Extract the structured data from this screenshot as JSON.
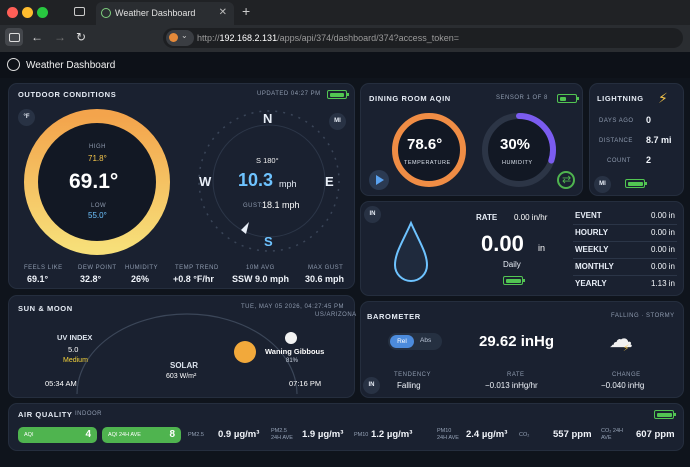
{
  "browser": {
    "tab_title": "Weather Dashboard",
    "url_prefix": "http://",
    "url_host": "192.168.2.131",
    "url_path": "/apps/api/374/dashboard/374?access_token="
  },
  "app": {
    "title": "Weather Dashboard"
  },
  "outdoor": {
    "title": "OUTDOOR CONDITIONS",
    "updated": "UPDATED 04:27 PM",
    "unit_badge": "°F",
    "high_label": "HIGH",
    "high": "71.8°",
    "temp": "69.1°",
    "low_label": "LOW",
    "low": "55.0°",
    "feels_label": "FEELS LIKE",
    "feels": "69.1°",
    "dew_label": "DEW POINT",
    "dew": "32.8°",
    "humidity_label": "HUMIDITY",
    "humidity": "26%",
    "trend_label": "TEMP TREND",
    "trend": "+0.8 °F/hr",
    "avg_label": "10M AVG",
    "avg": "SSW 9.0 mph",
    "gust_max_label": "MAX GUST",
    "gust_max": "30.6 mph"
  },
  "wind": {
    "unit_badge": "MI",
    "n": "N",
    "e": "E",
    "s": "S",
    "w": "W",
    "direction": "S 180°",
    "speed": "10.3",
    "speed_unit": "mph",
    "gust_label": "GUST:",
    "gust": "18.1 mph"
  },
  "indoor": {
    "title": "DINING ROOM AQIN",
    "sensor": "SENSOR 1 OF 8",
    "temp": "78.6°",
    "temp_label": "TEMPERATURE",
    "humidity": "30%",
    "humidity_label": "HUMIDITY",
    "humidity_pct": 30
  },
  "lightning": {
    "title": "LIGHTNING",
    "days_label": "DAYS AGO",
    "days": "0",
    "distance_label": "DISTANCE",
    "distance": "8.7 mi",
    "count_label": "COUNT",
    "count": "2",
    "unit_badge": "MI"
  },
  "rain": {
    "unit_badge": "IN",
    "rate_label": "RATE",
    "rate": "0.00 in/hr",
    "daily": "0.00",
    "daily_unit": "in",
    "daily_label": "Daily",
    "rows": [
      {
        "label": "EVENT",
        "value": "0.00 in"
      },
      {
        "label": "HOURLY",
        "value": "0.00 in"
      },
      {
        "label": "WEEKLY",
        "value": "0.00 in"
      },
      {
        "label": "MONTHLY",
        "value": "0.00 in"
      },
      {
        "label": "YEARLY",
        "value": "1.13 in"
      }
    ]
  },
  "sun": {
    "title": "SUN & MOON",
    "datetime": "TUE, MAY 05 2026, 04:27:45 PM",
    "tz": "US/ARIZONA",
    "uv_label": "UV INDEX",
    "uv": "5.0",
    "uv_level": "Medium",
    "solar_label": "SOLAR",
    "solar": "603 W/m²",
    "sunrise": "05:34 AM",
    "sunset": "07:16 PM",
    "moon_phase": "Waning Gibbous",
    "moon_pct": "81%"
  },
  "barometer": {
    "title": "BAROMETER",
    "status": "FALLING · STORMY",
    "rel": "Rel",
    "abs": "Abs",
    "pressure": "29.62 inHg",
    "unit_badge": "IN",
    "tendency_label": "TENDENCY",
    "tendency": "Falling",
    "rate_label": "RATE",
    "rate": "−0.013 inHg/hr",
    "change_label": "CHANGE",
    "change": "−0.040 inHg"
  },
  "air": {
    "title": "AIR QUALITY",
    "subtitle": "INDOOR",
    "aqi_label": "AQI",
    "aqi": "4",
    "aqi24_label": "AQI 24H AVE",
    "aqi24": "8",
    "pm25_label": "PM2.5",
    "pm25": "0.9 µg/m³",
    "pm25_24_label_1": "PM2.5",
    "pm25_24_label_2": "24H AVE",
    "pm25_24": "1.9 µg/m³",
    "pm10_label": "PM10",
    "pm10": "1.2 µg/m³",
    "pm10_24_label_1": "PM10",
    "pm10_24_label_2": "24H AVE",
    "pm10_24": "2.4 µg/m³",
    "co2_label": "CO₂",
    "co2": "557 ppm",
    "co2_24_label_1": "CO₂ 24H",
    "co2_24_label_2": "AVE",
    "co2_24": "607 ppm"
  },
  "colors": {
    "accent_yellow": "#f5c54a",
    "accent_blue": "#6ec3ff",
    "green": "#4fb44f",
    "purple": "#7b5cf0"
  }
}
